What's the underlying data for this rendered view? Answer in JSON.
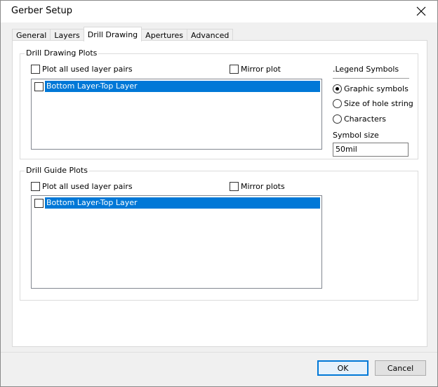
{
  "window": {
    "title": "Gerber Setup"
  },
  "tabs": [
    {
      "label": "General"
    },
    {
      "label": "Layers"
    },
    {
      "label": "Drill Drawing"
    },
    {
      "label": "Apertures"
    },
    {
      "label": "Advanced"
    }
  ],
  "drill_drawing": {
    "group_title": "Drill Drawing Plots",
    "plot_all_label": "Plot all used layer pairs",
    "mirror_label": "Mirror plot",
    "list_items": [
      {
        "label": "Bottom Layer-Top Layer",
        "checked": false,
        "selected": true
      }
    ],
    "legend": {
      "title": ".Legend Symbols",
      "options": [
        {
          "label": "Graphic symbols",
          "selected": true
        },
        {
          "label": "Size of hole string",
          "selected": false
        },
        {
          "label": "Characters",
          "selected": false
        }
      ],
      "symbol_size_label": "Symbol size",
      "symbol_size_value": "50mil"
    }
  },
  "drill_guide": {
    "group_title": "Drill Guide Plots",
    "plot_all_label": "Plot all used layer pairs",
    "mirror_label": "Mirror plots",
    "list_items": [
      {
        "label": "Bottom Layer-Top Layer",
        "checked": false,
        "selected": true
      }
    ]
  },
  "buttons": {
    "ok": "OK",
    "cancel": "Cancel"
  },
  "colors": {
    "selection": "#0078d7",
    "dialog_bg": "#f0f0f0"
  }
}
